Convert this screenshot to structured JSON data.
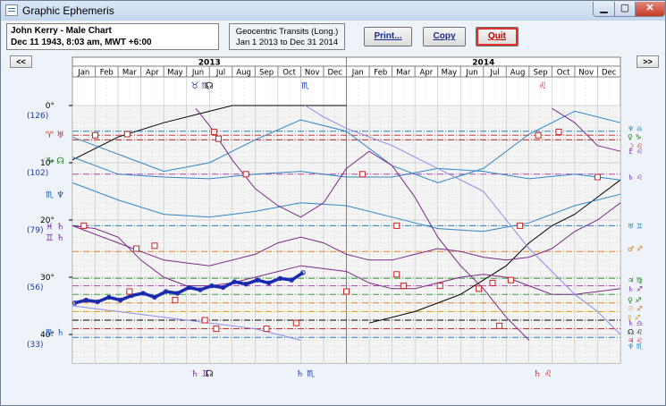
{
  "window": {
    "title": "Graphic Ephemeris"
  },
  "chart_info": {
    "name_line": "John Kerry - Male Chart",
    "date_line": "Dec 11 1943, 8:03 am, MWT +6:00",
    "transit_type": "Geocentric Transits (Long.)",
    "range": "Jan 1 2013 to Dec 31 2014"
  },
  "buttons": {
    "print": "Print...",
    "copy": "Copy",
    "quit": "Quit"
  },
  "nav": {
    "prev": "<<",
    "next": ">>"
  },
  "colors": {
    "background": "#eef3f9",
    "grid": "#c8c8c8",
    "black_line": "#000000",
    "blue_line": "#2f86c8",
    "purple_line": "#7a2a88",
    "lavender_line": "#8b8cf0",
    "moon_trace": "#1a2ab0",
    "marker": "#cc2222",
    "natal_dashes": [
      "#d04040",
      "#b040b0",
      "#2080c0",
      "#e08020",
      "#000080",
      "#40a040",
      "#000000"
    ]
  },
  "chart_data": {
    "type": "line",
    "years": [
      {
        "label": "2013",
        "months": [
          "Jan",
          "Feb",
          "Mar",
          "Apr",
          "May",
          "Jun",
          "Jul",
          "Aug",
          "Sep",
          "Oct",
          "Nov",
          "Dec"
        ]
      },
      {
        "label": "2014",
        "months": [
          "Jan",
          "Feb",
          "Mar",
          "Apr",
          "May",
          "Jun",
          "Jul",
          "Aug",
          "Sep",
          "Oct",
          "Nov",
          "Dec"
        ]
      }
    ],
    "y_ticks": [
      {
        "deg": 0,
        "label": "0°",
        "alt": "(126)"
      },
      {
        "deg": 10,
        "label": "10°",
        "alt": "(102)"
      },
      {
        "deg": 20,
        "label": "20°",
        "alt": "(79)"
      },
      {
        "deg": 30,
        "label": "30°",
        "alt": "(56)"
      },
      {
        "deg": 40,
        "label": "40°",
        "alt": "(33)"
      }
    ],
    "ylim": [
      0,
      45
    ],
    "xlim_months": [
      0,
      24
    ],
    "left_natal_glyphs": [
      {
        "deg": 5,
        "glyphs": "♈ ♅",
        "color": "#c03030"
      },
      {
        "deg": 9.5,
        "glyphs": "♑ ☊",
        "color": "#208020"
      },
      {
        "deg": 15.5,
        "glyphs": "♏ ♆",
        "color": "#1c5aa8"
      },
      {
        "deg": 21,
        "glyphs": "♓ ♄",
        "color": "#7030a0"
      },
      {
        "deg": 23,
        "glyphs": "♊ ♄",
        "color": "#7030a0"
      },
      {
        "deg": 39.5,
        "glyphs": "♏ ♄",
        "color": "#1c5aa8"
      }
    ],
    "right_natal_glyphs": [
      {
        "deg": 4,
        "glyphs": "♆ ♎",
        "color": "#1c8ab8"
      },
      {
        "deg": 5.5,
        "glyphs": "♀ ♑",
        "color": "#208020"
      },
      {
        "deg": 7,
        "glyphs": "☽ ♌",
        "color": "#c03030"
      },
      {
        "deg": 8,
        "glyphs": "♇ ♌",
        "color": "#7030a0"
      },
      {
        "deg": 12.5,
        "glyphs": "♄ ♌",
        "color": "#7030a0"
      },
      {
        "deg": 21,
        "glyphs": "♅ ♊",
        "color": "#1c8ab8"
      },
      {
        "deg": 25,
        "glyphs": "♂ ♐",
        "color": "#e07010"
      },
      {
        "deg": 30.5,
        "glyphs": "♃ ♍",
        "color": "#208020"
      },
      {
        "deg": 32,
        "glyphs": "♄ ♐",
        "color": "#7030a0"
      },
      {
        "deg": 34,
        "glyphs": "♀ ♐",
        "color": "#208020"
      },
      {
        "deg": 35.5,
        "glyphs": "☉ ♐",
        "color": "#e07010"
      },
      {
        "deg": 37,
        "glyphs": "☿ ♐",
        "color": "#e0a000"
      },
      {
        "deg": 38,
        "glyphs": "♄ ♎",
        "color": "#7030a0"
      },
      {
        "deg": 39.5,
        "glyphs": "☊ ♌",
        "color": "#000000"
      },
      {
        "deg": 41,
        "glyphs": "♃ ♌",
        "color": "#c03030"
      },
      {
        "deg": 42,
        "glyphs": "♆ ♏",
        "color": "#1c8ab8"
      }
    ],
    "top_glyphs": [
      {
        "month": 5.6,
        "glyphs": "♉ ♏",
        "color": "#1c3aa8"
      },
      {
        "month": 6.0,
        "glyphs": "☊",
        "color": "#000000"
      },
      {
        "month": 10.2,
        "glyphs": "♏",
        "color": "#1c3aa8"
      },
      {
        "month": 20.6,
        "glyphs": "♌",
        "color": "#c03030"
      }
    ],
    "bottom_glyphs": [
      {
        "month": 5.6,
        "glyphs": "♄ ♊",
        "color": "#7030a0"
      },
      {
        "month": 6.0,
        "glyphs": "☊",
        "color": "#000000"
      },
      {
        "month": 10.2,
        "glyphs": "♄ ♏",
        "color": "#1c3aa8"
      },
      {
        "month": 20.6,
        "glyphs": "♄ ♌",
        "color": "#c03030"
      }
    ],
    "natal_lines": [
      {
        "deg": 4.5,
        "color": "#2080c0",
        "style": "dashdot"
      },
      {
        "deg": 5.2,
        "color": "#d04040",
        "style": "dashdot"
      },
      {
        "deg": 6.0,
        "color": "#c02020",
        "style": "dashdot"
      },
      {
        "deg": 12.0,
        "color": "#b040b0",
        "style": "dashdot"
      },
      {
        "deg": 21.0,
        "color": "#2080c0",
        "style": "dashdot"
      },
      {
        "deg": 25.5,
        "color": "#e08020",
        "style": "dashdot"
      },
      {
        "deg": 30.2,
        "color": "#40a040",
        "style": "dashdot"
      },
      {
        "deg": 31.5,
        "color": "#b040b0",
        "style": "dashdot"
      },
      {
        "deg": 33.0,
        "color": "#40a040",
        "style": "dashdot"
      },
      {
        "deg": 34.5,
        "color": "#e08020",
        "style": "dashdot"
      },
      {
        "deg": 36.0,
        "color": "#e0a000",
        "style": "dashdot"
      },
      {
        "deg": 37.5,
        "color": "#000000",
        "style": "dashdot"
      },
      {
        "deg": 39.0,
        "color": "#c02020",
        "style": "dashdot"
      },
      {
        "deg": 40.5,
        "color": "#2080c0",
        "style": "dashdot"
      }
    ],
    "series": [
      {
        "color": "#000000",
        "x": [
          0,
          2,
          4,
          6,
          7,
          8,
          10,
          12,
          13,
          15,
          17,
          19,
          20,
          21,
          22,
          23,
          24
        ],
        "y": [
          9.5,
          5.5,
          3,
          1,
          0,
          0,
          0,
          0,
          38,
          36,
          33,
          28,
          24,
          21,
          19,
          16,
          13
        ]
      },
      {
        "color": "#2f86c8",
        "x": [
          0,
          2,
          4,
          6,
          8,
          10,
          12,
          14,
          16,
          18,
          20,
          22,
          24
        ],
        "y": [
          9.0,
          12.0,
          12.5,
          12.8,
          12.0,
          11.5,
          12.5,
          12.5,
          11.0,
          11.5,
          12.8,
          12.0,
          13.0
        ]
      },
      {
        "color": "#2f86c8",
        "x": [
          0,
          2,
          4,
          6,
          8,
          10,
          12,
          14,
          16,
          18,
          20,
          22,
          24
        ],
        "y": [
          13.5,
          16.5,
          19.0,
          19.5,
          18.5,
          17.0,
          17.5,
          19.5,
          21.5,
          22.0,
          20.5,
          17.5,
          15.5
        ]
      },
      {
        "color": "#2f86c8",
        "x": [
          0,
          2,
          4,
          6,
          8,
          10,
          12,
          14,
          16,
          18,
          20,
          22,
          24
        ],
        "y": [
          5.5,
          8.5,
          11.5,
          10.0,
          6.0,
          2.5,
          4.5,
          10.5,
          13.5,
          11.0,
          5.0,
          1.0,
          3.0
        ]
      },
      {
        "color": "#7a2a88",
        "x": [
          0,
          1,
          2,
          3,
          4,
          5,
          6,
          7,
          8,
          9,
          10,
          11,
          12,
          13,
          14,
          15,
          16,
          17,
          18,
          19,
          20,
          21,
          22,
          23,
          24
        ],
        "y": [
          21,
          21.5,
          23,
          27,
          30,
          31.5,
          31.5,
          31,
          30,
          29,
          28,
          28.5,
          29,
          31,
          32,
          32,
          31,
          30,
          29.5,
          30,
          31.5,
          33,
          33,
          32.5,
          32
        ]
      },
      {
        "color": "#7a2a88",
        "x": [
          0,
          2,
          4,
          6,
          8,
          9,
          10,
          11,
          12,
          13,
          14,
          15,
          16,
          17,
          18,
          19,
          20,
          21,
          22,
          23,
          24
        ],
        "y": [
          21,
          24,
          27,
          28,
          26,
          24,
          23,
          24,
          26,
          27,
          27,
          26,
          25,
          25.5,
          26.5,
          27,
          26.5,
          25,
          22,
          20,
          17
        ]
      },
      {
        "color": "#7a2a88",
        "x": [
          5.4,
          6.0,
          7.0,
          8.0,
          9.0,
          10.0,
          11.0,
          12.0,
          13.0,
          14.0,
          15.0,
          16.0,
          17.0,
          18.0,
          19.0,
          20.0,
          21.0,
          22.0,
          23.0,
          24.0
        ],
        "y": [
          0.5,
          3.5,
          9.5,
          14.5,
          17.5,
          19.5,
          17.0,
          11.0,
          8.0,
          10.5,
          16.0,
          23.0,
          28.0,
          32.0,
          37.0,
          41.0,
          0.5,
          3.0,
          7.0,
          8.0
        ]
      },
      {
        "color": "#8b8cf0",
        "x": [
          0,
          2,
          4,
          6,
          8,
          10,
          10.2,
          11,
          12,
          14,
          16,
          18,
          19,
          20,
          21,
          22,
          23,
          24
        ],
        "y": [
          35,
          36,
          37,
          38,
          39,
          41,
          0,
          2,
          4,
          7,
          11,
          15,
          20,
          25,
          29,
          33,
          36,
          40
        ]
      }
    ],
    "moon_trace": {
      "color": "#1a2ab0",
      "x": [
        0.1,
        0.6,
        1.1,
        1.6,
        2.1,
        2.6,
        3.1,
        3.6,
        4.1,
        4.6,
        5.1,
        5.6,
        6.1,
        6.6,
        7.1,
        7.6,
        8.1,
        8.6,
        9.1,
        9.6,
        10.1
      ],
      "y": [
        34.5,
        34.0,
        34.3,
        33.5,
        34.0,
        33.2,
        32.8,
        33.5,
        32.5,
        32.8,
        31.8,
        32.2,
        31.5,
        31.8,
        30.8,
        31.2,
        30.5,
        31.0,
        30.2,
        30.5,
        29.2
      ]
    },
    "markers": [
      {
        "x": 1.0,
        "y": 5.2
      },
      {
        "x": 2.4,
        "y": 5.0
      },
      {
        "x": 6.2,
        "y": 4.6
      },
      {
        "x": 6.4,
        "y": 5.8
      },
      {
        "x": 7.6,
        "y": 12.0
      },
      {
        "x": 12.7,
        "y": 12.0
      },
      {
        "x": 14.2,
        "y": 21.0
      },
      {
        "x": 19.6,
        "y": 21.0
      },
      {
        "x": 20.4,
        "y": 5.2
      },
      {
        "x": 21.3,
        "y": 4.6
      },
      {
        "x": 23.0,
        "y": 12.5
      },
      {
        "x": 2.5,
        "y": 32.5
      },
      {
        "x": 4.5,
        "y": 34.0
      },
      {
        "x": 5.8,
        "y": 37.5
      },
      {
        "x": 6.3,
        "y": 39.0
      },
      {
        "x": 8.5,
        "y": 39.0
      },
      {
        "x": 9.8,
        "y": 38.0
      },
      {
        "x": 14.5,
        "y": 31.5
      },
      {
        "x": 17.8,
        "y": 32.0
      },
      {
        "x": 18.4,
        "y": 31.0
      },
      {
        "x": 18.7,
        "y": 38.5
      },
      {
        "x": 12.0,
        "y": 32.5
      },
      {
        "x": 14.2,
        "y": 29.5
      },
      {
        "x": 16.1,
        "y": 31.5
      },
      {
        "x": 19.2,
        "y": 30.5
      },
      {
        "x": 3.6,
        "y": 24.5
      },
      {
        "x": 0.5,
        "y": 21.0
      },
      {
        "x": 2.8,
        "y": 25.0
      }
    ]
  }
}
